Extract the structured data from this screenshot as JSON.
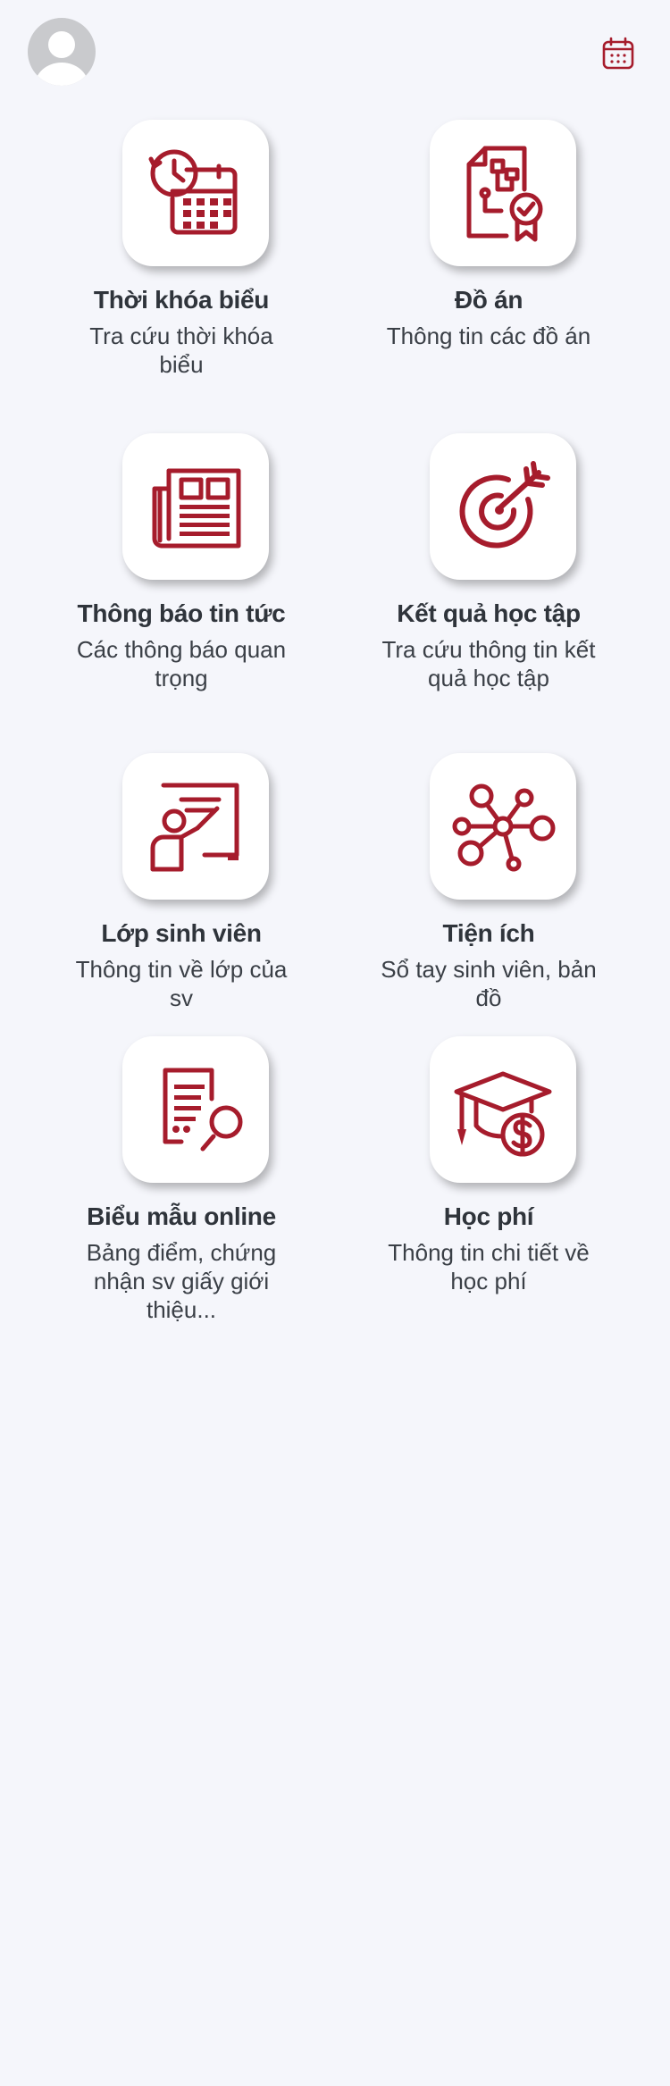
{
  "header": {
    "avatar_icon": "user-avatar-icon",
    "calendar_icon": "calendar-icon"
  },
  "theme": {
    "accent": "#a61c2c",
    "background": "#f5f6fb",
    "tile_background": "#ffffff",
    "title_color": "#2f343b"
  },
  "menu": [
    {
      "title": "Thời khóa biểu",
      "description": "Tra cứu thời khóa biểu",
      "icon": "schedule-clock-calendar-icon"
    },
    {
      "title": "Đồ án",
      "description": "Thông tin các đồ án",
      "icon": "project-document-check-icon"
    },
    {
      "title": "Thông báo tin tức",
      "description": "Các thông báo quan trọng",
      "icon": "newspaper-icon"
    },
    {
      "title": "Kết quả học tập",
      "description": "Tra cứu thông tin kết quả học tập",
      "icon": "target-arrow-icon"
    },
    {
      "title": "Lớp sinh viên",
      "description": "Thông tin về lớp của sv",
      "icon": "teacher-board-icon"
    },
    {
      "title": "Tiện ích",
      "description": "Sổ tay sinh viên, bản đồ",
      "icon": "network-nodes-icon"
    },
    {
      "title": "Biểu mẫu online",
      "description": "Bảng điểm, chứng nhận sv giấy giới thiệu...",
      "icon": "form-document-icon"
    },
    {
      "title": "Học phí",
      "description": "Thông tin chi tiết về học phí",
      "icon": "graduation-cap-dollar-icon"
    }
  ]
}
